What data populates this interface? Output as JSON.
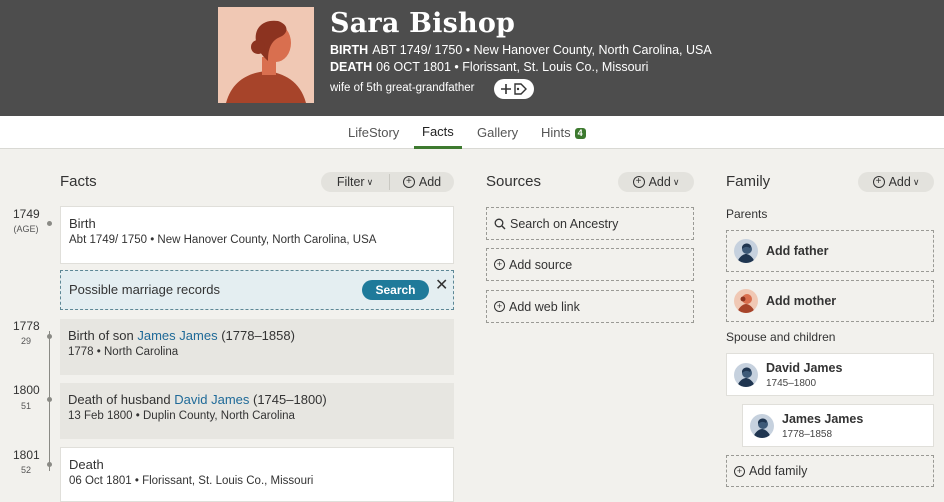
{
  "person": {
    "name": "Sara Bishop",
    "birth_label": "BIRTH",
    "birth_value": "ABT 1749/ 1750 • New Hanover County, North Carolina, USA",
    "death_label": "DEATH",
    "death_value": "06 OCT 1801 • Florissant, St. Louis Co., Missouri",
    "relation": "wife of 5th great-grandfather"
  },
  "tabs": [
    {
      "label": "LifeStory"
    },
    {
      "label": "Facts"
    },
    {
      "label": "Gallery"
    },
    {
      "label": "Hints",
      "badge": "4"
    }
  ],
  "facts": {
    "title": "Facts",
    "filter_label": "Filter",
    "add_label": "Add",
    "timeline": [
      {
        "year": "1749",
        "age": "(AGE)"
      },
      {
        "year": "1778",
        "age": "29"
      },
      {
        "year": "1800",
        "age": "51"
      },
      {
        "year": "1801",
        "age": "52"
      }
    ],
    "items": [
      {
        "title": "Birth",
        "sub": "Abt 1749/ 1750 • New Hanover County, North Carolina, USA"
      },
      {
        "title_prefix": "Birth of son ",
        "link": "James James",
        "title_suffix": " (1778–1858)",
        "sub": "1778 • North Carolina"
      },
      {
        "title_prefix": "Death of husband ",
        "link": "David James",
        "title_suffix": " (1745–1800)",
        "sub": "13 Feb 1800 • Duplin County, North Carolina"
      },
      {
        "title": "Death",
        "sub": "06 Oct 1801 • Florissant, St. Louis Co., Missouri"
      }
    ],
    "marriage": {
      "text": "Possible marriage records",
      "search_label": "Search",
      "close": "✕"
    }
  },
  "sources": {
    "title": "Sources",
    "add_label": "Add",
    "items": [
      {
        "label": "Search on Ancestry"
      },
      {
        "label": "Add source"
      },
      {
        "label": "Add web link"
      }
    ]
  },
  "family": {
    "title": "Family",
    "add_label": "Add",
    "parents_label": "Parents",
    "add_father": "Add father",
    "add_mother": "Add mother",
    "spouse_label": "Spouse and children",
    "spouse": {
      "name": "David James",
      "dates": "1745–1800"
    },
    "child": {
      "name": "James James",
      "dates": "1778–1858"
    },
    "add_family": "Add family"
  },
  "colors": {
    "header_bg": "#4d4d4d",
    "active_tab": "#3d7a2f",
    "link": "#1f6a98",
    "search_button": "#1f7a9a"
  }
}
